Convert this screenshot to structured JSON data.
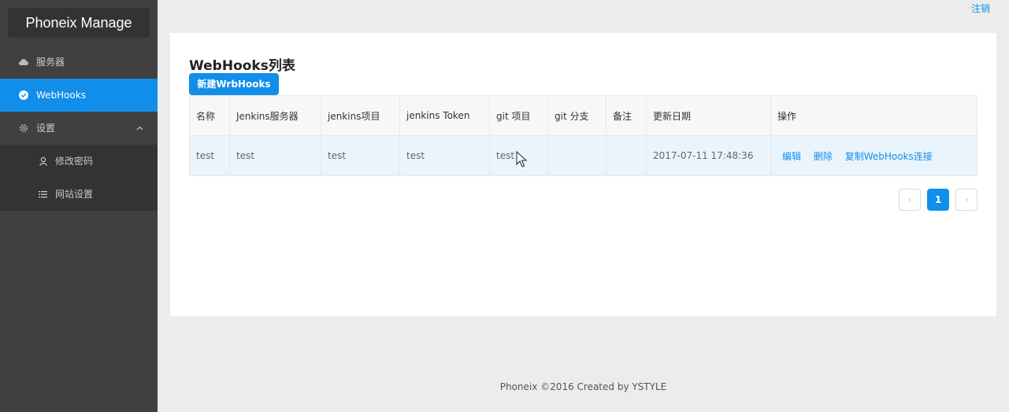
{
  "app": {
    "title": "Phoneix Manage"
  },
  "sidebar": {
    "items": [
      {
        "label": "服务器",
        "icon": "cloud-icon"
      },
      {
        "label": "WebHooks",
        "icon": "check-circle-icon"
      },
      {
        "label": "设置",
        "icon": "gear-icon"
      }
    ],
    "submenu": [
      {
        "label": "修改密码",
        "icon": "user-icon"
      },
      {
        "label": "网站设置",
        "icon": "list-icon"
      }
    ]
  },
  "header": {
    "logout": "注销"
  },
  "main": {
    "title": "WebHooks列表",
    "new_button": "新建WrbHooks",
    "table": {
      "columns": [
        "名称",
        "Jenkins服务器",
        "jenkins项目",
        "jenkins Token",
        "git 项目",
        "git 分支",
        "备注",
        "更新日期",
        "操作"
      ],
      "rows": [
        {
          "name": "test",
          "server": "test",
          "project": "test",
          "token": "test",
          "git_project": "test",
          "git_branch": "",
          "remark": "",
          "updated": "2017-07-11 17:48:36"
        }
      ],
      "actions": [
        "编辑",
        "删除",
        "复制WebHooks连接"
      ]
    },
    "pagination": {
      "prev": "‹",
      "current": "1",
      "next": "›"
    }
  },
  "footer": {
    "text": "Phoneix ©2016 Created by YSTYLE"
  },
  "colors": {
    "accent": "#108ee9",
    "sidebar": "#404040"
  }
}
